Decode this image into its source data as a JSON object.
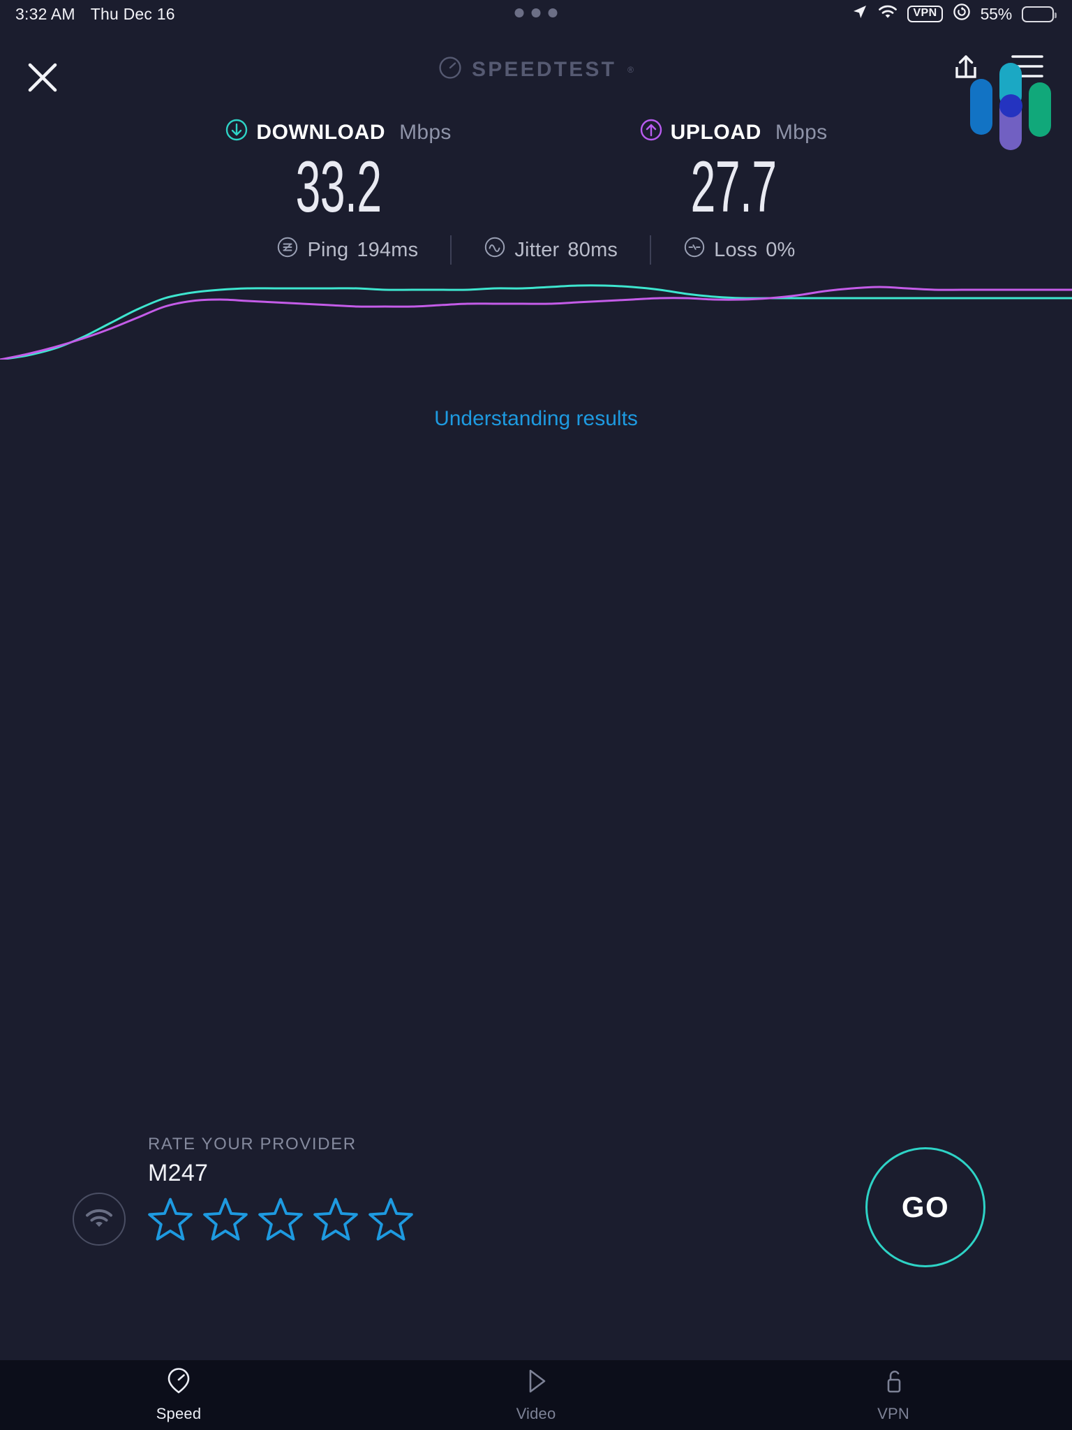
{
  "status_bar": {
    "time": "3:32 AM",
    "date": "Thu Dec 16",
    "battery_percent": "55%",
    "vpn_label": "VPN",
    "icons": [
      "location-arrow-icon",
      "wifi-icon",
      "vpn-badge-icon",
      "rotation-lock-icon",
      "battery-icon"
    ]
  },
  "header": {
    "close_label": "close-icon",
    "brand": "SPEEDTEST",
    "brand_trademark": "®",
    "share_icon": "share-icon",
    "menu_icon": "hamburger-menu-icon"
  },
  "results": {
    "download": {
      "label": "DOWNLOAD",
      "unit": "Mbps",
      "value": "33.2",
      "color": "#2ed3c6",
      "icon": "download-arrow-icon"
    },
    "upload": {
      "label": "UPLOAD",
      "unit": "Mbps",
      "value": "27.7",
      "color": "#b85cf0",
      "icon": "upload-arrow-icon"
    },
    "ping": {
      "label": "Ping",
      "value": "194ms",
      "icon": "ping-icon"
    },
    "jitter": {
      "label": "Jitter",
      "value": "80ms",
      "icon": "jitter-icon"
    },
    "loss": {
      "label": "Loss",
      "value": "0%",
      "icon": "loss-icon"
    },
    "understanding_link": "Understanding results"
  },
  "chart_data": {
    "type": "line",
    "title": "",
    "xlabel": "",
    "ylabel": "",
    "grid": false,
    "legend": "none",
    "series": [
      {
        "name": "Download",
        "color": "#3ee6cf",
        "points": [
          0,
          3,
          8,
          16,
          26,
          36,
          44,
          48,
          50,
          51,
          51,
          51,
          51,
          51,
          50,
          50,
          50,
          50,
          51,
          51,
          52,
          53,
          53,
          52,
          50,
          47,
          45,
          44,
          44,
          44,
          44,
          44,
          44,
          44,
          44,
          44,
          44,
          44,
          44,
          44
        ]
      },
      {
        "name": "Upload",
        "color": "#c45ce8",
        "points": [
          0,
          4,
          9,
          15,
          22,
          30,
          38,
          42,
          43,
          42,
          41,
          40,
          39,
          38,
          38,
          38,
          39,
          40,
          40,
          40,
          40,
          41,
          42,
          43,
          44,
          44,
          43,
          43,
          44,
          46,
          49,
          51,
          52,
          51,
          50,
          50,
          50,
          50,
          50,
          50
        ]
      }
    ]
  },
  "rate_provider": {
    "title": "RATE YOUR PROVIDER",
    "isp": "M247",
    "wifi_icon": "wifi-circle-icon",
    "star_count": 5,
    "stars_filled": 0,
    "star_color": "#1e9ae0"
  },
  "go_button": {
    "label": "GO",
    "color": "#2ed3c6"
  },
  "tabs": [
    {
      "label": "Speed",
      "icon": "speed-gauge-icon",
      "active": true
    },
    {
      "label": "Video",
      "icon": "video-play-icon",
      "active": false
    },
    {
      "label": "VPN",
      "icon": "vpn-unlock-icon",
      "active": false
    }
  ]
}
